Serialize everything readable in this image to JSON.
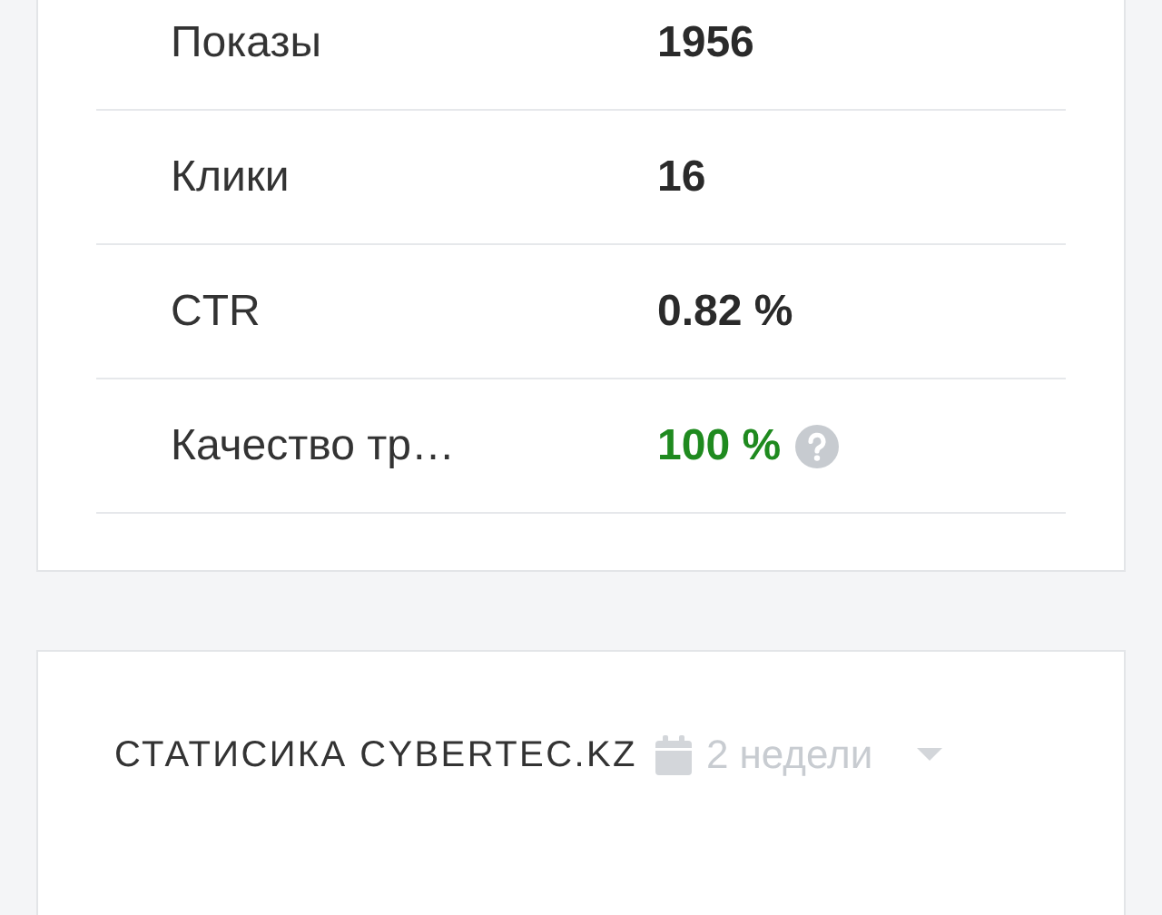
{
  "stats": [
    {
      "label": "Показы",
      "value": "1956",
      "kind": "plain"
    },
    {
      "label": "Клики",
      "value": "16",
      "kind": "plain"
    },
    {
      "label": "CTR",
      "value": "0.82 %",
      "kind": "plain"
    },
    {
      "label": "Качество тр…",
      "value": "100 %",
      "kind": "quality"
    }
  ],
  "panel": {
    "title": "СТАТИСИКА CYBERTEC.KZ",
    "period": "2 недели"
  }
}
